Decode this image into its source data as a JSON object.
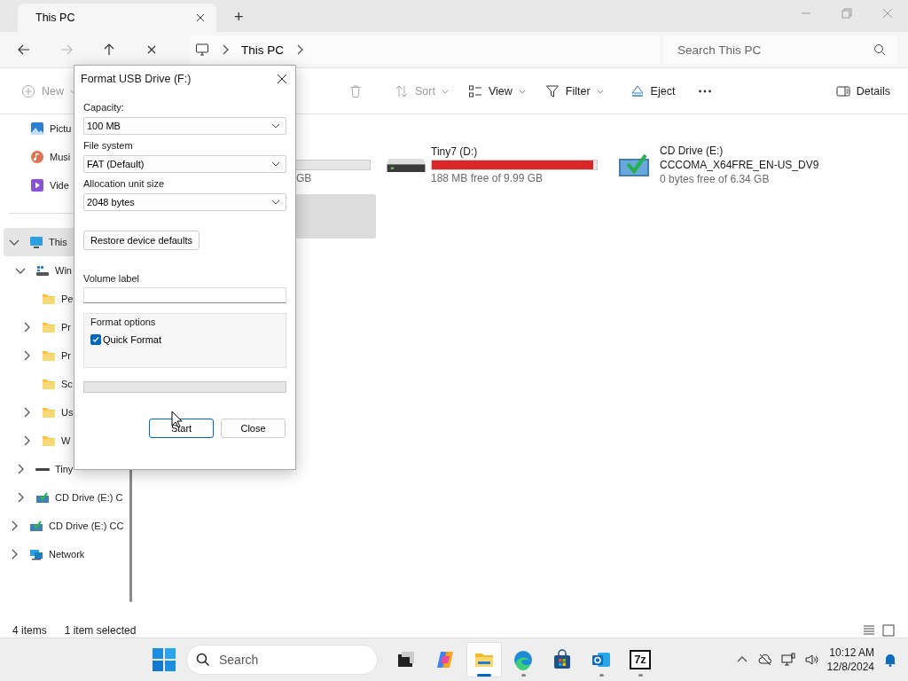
{
  "window": {
    "tab_title": "This PC",
    "new_tab": "+"
  },
  "address_bar": {
    "crumbs": [
      "This PC"
    ],
    "search_placeholder": "Search This PC",
    "forward_disabled": true
  },
  "command_bar": [
    {
      "kind": "new",
      "label": "New",
      "disabled": true
    },
    {
      "kind": "delete",
      "disabled": true
    },
    {
      "kind": "sort",
      "label": "Sort",
      "disabled": true
    },
    {
      "kind": "view",
      "label": "View",
      "disabled": false
    },
    {
      "kind": "filter",
      "label": "Filter",
      "disabled": false
    },
    {
      "kind": "eject",
      "label": "Eject",
      "disabled": false
    },
    {
      "kind": "more",
      "disabled": false
    },
    {
      "kind": "details",
      "label": "Details",
      "disabled": false
    }
  ],
  "quick_access": [
    {
      "label": "Pictu",
      "kind": "pictures",
      "selected": false
    },
    {
      "label": "Musi",
      "kind": "music",
      "selected": false
    },
    {
      "label": "Vide",
      "kind": "videos",
      "selected": false
    }
  ],
  "tree": [
    {
      "label": "This",
      "kind": "pc",
      "expanded": true,
      "selected": true,
      "children": [
        {
          "label": "Win",
          "kind": "system-drive",
          "expanded": true,
          "selected": false,
          "children": [
            {
              "label": "Pe",
              "kind": "folder",
              "selected": false
            },
            {
              "label": "Pr",
              "kind": "folder",
              "expanded": false,
              "selected": false
            },
            {
              "label": "Pr",
              "kind": "folder",
              "expanded": false,
              "selected": false
            },
            {
              "label": "Sc",
              "kind": "folder",
              "selected": false
            },
            {
              "label": "Us",
              "kind": "folder",
              "expanded": false,
              "selected": false
            },
            {
              "label": "W",
              "kind": "folder",
              "expanded": false,
              "selected": false
            }
          ]
        },
        {
          "label": "Tiny",
          "kind": "drive",
          "expanded": false,
          "selected": false
        },
        {
          "label": "CD Drive (E:) C",
          "kind": "cd",
          "expanded": false,
          "selected": false
        }
      ]
    },
    {
      "label": "CD Drive (E:) CC",
      "kind": "cd",
      "expanded": false,
      "selected": false
    },
    {
      "label": "Network",
      "kind": "network",
      "expanded": false,
      "selected": false
    }
  ],
  "drives": [
    {
      "covered": true,
      "bar": true,
      "selected": false,
      "free": "GB"
    },
    {
      "covered": false,
      "selected": false,
      "kind": "drive",
      "name": "Tiny7 (D:)",
      "level": 0.98,
      "color": "#da2626",
      "free": "188 MB free of 9.99 GB"
    },
    {
      "covered": false,
      "selected": false,
      "kind": "cd",
      "name": "CD Drive (E:)",
      "label": "CCCOMA_X64FRE_EN-US_DV9",
      "free": "0 bytes free of 6.34 GB"
    },
    {
      "covered": true,
      "selected": true
    }
  ],
  "status_bar": {
    "count": "4 items",
    "selection": "1 item selected"
  },
  "dialog": {
    "title": "Format USB Drive (F:)",
    "fields": [
      {
        "label": "Capacity:",
        "value": "100 MB"
      },
      {
        "label": "File system",
        "value": "FAT (Default)"
      },
      {
        "label": "Allocation unit size",
        "value": "2048 bytes"
      }
    ],
    "restore_button": "Restore device defaults",
    "volume_label": "Volume label",
    "options_title": "Format options",
    "quick_format": {
      "label": "Quick Format",
      "checked": true
    },
    "progress": {
      "level": 0
    },
    "start_button": "Start",
    "close_button": "Close"
  },
  "taskbar": {
    "search_placeholder": "Search",
    "apps": [
      {
        "kind": "task-view",
        "running": false,
        "focused": false
      },
      {
        "kind": "copilot",
        "running": false,
        "focused": false
      },
      {
        "kind": "explorer",
        "running": true,
        "focused": true
      },
      {
        "kind": "edge",
        "running": true,
        "focused": false
      },
      {
        "kind": "store",
        "running": false,
        "focused": false
      },
      {
        "kind": "outlook",
        "running": true,
        "focused": false
      },
      {
        "kind": "archiver",
        "label": "7z",
        "running": true,
        "focused": false
      }
    ],
    "time": "10:12 AM",
    "date": "12/8/2024"
  }
}
